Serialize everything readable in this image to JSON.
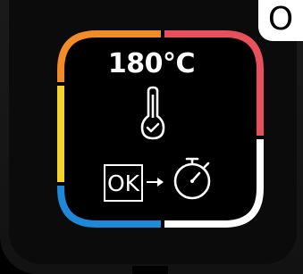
{
  "display": {
    "temperature": "180°C",
    "ok_label": "OK",
    "corner_badge": "O",
    "icons": [
      "thermometer-check-icon",
      "right-arrow-icon",
      "timer-icon"
    ]
  },
  "ring_colors": {
    "orange": "#F28C28",
    "red": "#E8505B",
    "yellow": "#F4D32A",
    "blue": "#1E88D9",
    "white": "#FFFFFF"
  }
}
